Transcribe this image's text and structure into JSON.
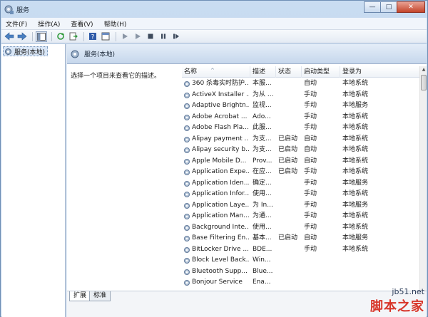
{
  "window": {
    "title": "服务",
    "minimize_glyph": "—",
    "maximize_glyph": "□",
    "close_glyph": "✕"
  },
  "menu": [
    "文件(F)",
    "操作(A)",
    "查看(V)",
    "帮助(H)"
  ],
  "tree": {
    "root_label": "服务(本地)"
  },
  "pane": {
    "title": "服务(本地)",
    "description": "选择一个项目来查看它的描述。"
  },
  "columns": {
    "name": "名称",
    "description": "描述",
    "status": "状态",
    "startup": "启动类型",
    "logon": "登录为"
  },
  "services": [
    {
      "name": "360 杀毒实时防护...",
      "description": "本服...",
      "status": "",
      "startup": "自动",
      "logon": "本地系统"
    },
    {
      "name": "ActiveX Installer ...",
      "description": "为从 ...",
      "status": "",
      "startup": "手动",
      "logon": "本地系统"
    },
    {
      "name": "Adaptive Brightn...",
      "description": "监视...",
      "status": "",
      "startup": "手动",
      "logon": "本地服务"
    },
    {
      "name": "Adobe Acrobat ...",
      "description": "Ado...",
      "status": "",
      "startup": "手动",
      "logon": "本地系统"
    },
    {
      "name": "Adobe Flash Pla...",
      "description": "此服...",
      "status": "",
      "startup": "手动",
      "logon": "本地系统"
    },
    {
      "name": "Alipay payment ...",
      "description": "为支...",
      "status": "已启动",
      "startup": "自动",
      "logon": "本地系统"
    },
    {
      "name": "Alipay security b...",
      "description": "为支...",
      "status": "已启动",
      "startup": "自动",
      "logon": "本地系统"
    },
    {
      "name": "Apple Mobile D...",
      "description": "Prov...",
      "status": "已启动",
      "startup": "自动",
      "logon": "本地系统"
    },
    {
      "name": "Application Expe...",
      "description": "在应...",
      "status": "已启动",
      "startup": "手动",
      "logon": "本地系统"
    },
    {
      "name": "Application Iden...",
      "description": "确定...",
      "status": "",
      "startup": "手动",
      "logon": "本地服务"
    },
    {
      "name": "Application Infor...",
      "description": "使用...",
      "status": "",
      "startup": "手动",
      "logon": "本地系统"
    },
    {
      "name": "Application Laye...",
      "description": "为 In...",
      "status": "",
      "startup": "手动",
      "logon": "本地服务"
    },
    {
      "name": "Application Man...",
      "description": "为通...",
      "status": "",
      "startup": "手动",
      "logon": "本地系统"
    },
    {
      "name": "Background Inte...",
      "description": "使用...",
      "status": "",
      "startup": "手动",
      "logon": "本地系统"
    },
    {
      "name": "Base Filtering En...",
      "description": "基本...",
      "status": "已启动",
      "startup": "自动",
      "logon": "本地服务"
    },
    {
      "name": "BitLocker Drive ...",
      "description": "BDE...",
      "status": "",
      "startup": "手动",
      "logon": "本地系统"
    },
    {
      "name": "Block Level Back...",
      "description": "Win...",
      "status": "",
      "startup": "",
      "logon": ""
    },
    {
      "name": "Bluetooth Supp...",
      "description": "Blue...",
      "status": "",
      "startup": "",
      "logon": ""
    },
    {
      "name": "Bonjour Service",
      "description": "Ena...",
      "status": "",
      "startup": "",
      "logon": ""
    }
  ],
  "tabs": [
    "扩展",
    "标准"
  ],
  "watermark": {
    "line1": "jb51.net",
    "line2": "脚本之家"
  }
}
